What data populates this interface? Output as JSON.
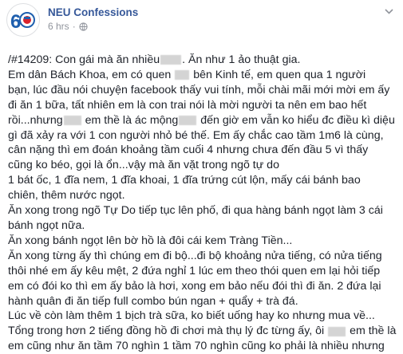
{
  "page": {
    "name": "NEU Confessions",
    "time": "6 hrs",
    "privacy_icon": "globe-icon",
    "menu_icon": "chevron-down-icon",
    "avatar_text": "60"
  },
  "post": {
    "lines": [
      "/#14209: Con gái mà ăn nhiều",
      "Ăn như 1 ảo thuật gia.",
      "Em dân Bách Khoa, em có quen",
      "bên Kinh tế, em quen qua 1 người",
      "bạn, lúc đầu nói chuyện facebook thấy vui tính, mỗi chài mãi mới mời em ấy",
      "đi ăn 1 bữa, tất nhiên em là con trai nói là mời người ta nên em bao hết",
      "rồi...nhưng",
      "em thề là ác mộng",
      "đến giờ em vẫn ko hiểu đc điều kì diệu",
      "gì đã xảy ra với 1 con người nhỏ bé thế. Em ấy chắc cao tầm 1m6 là cùng,",
      "cân nặng thì em đoán khoảng tầm cuối 4 nhưng chưa đến đầu 5 vì thấy",
      "cũng ko béo, gọi là ổn...vậy mà ăn vặt trong ngõ tự do",
      "1 bát ốc, 1 đĩa nem, 1 đĩa khoai, 1 đĩa trứng cút lộn, mấy cái bánh bao",
      "chiên, thêm nước ngọt.",
      "Ăn xong trong ngõ Tự Do tiếp tục lên phố, đi qua hàng bánh ngọt làm 3 cái",
      "bánh ngọt nữa.",
      "Ăn xong bánh ngọt lên bờ hồ là đôi cái kem Tràng Tiền...",
      "Ăn xong từng ấy thì chúng em đi bộ...đi bộ khoảng nửa tiếng, có nửa tiếng",
      "thôi nhé em ấy kêu mệt, 2 đứa nghỉ 1 lúc em theo thói quen em lại hỏi tiếp",
      "em có đói ko thì em ấy bảo là hơi, xong em bảo nếu đói thì đi ăn. 2 đứa lại",
      "hành quân đi ăn tiếp full combo bún ngan + quẩy + trà đá.",
      "Lúc về còn làm thêm 1 bịch trà sữa, ko biết uống hay ko nhưng mua về...",
      "Tổng trong hơn 2 tiếng đồng hồ đi chơi mà thụ lý đc từng ấy, ôi",
      "em thề là",
      "em cũng như ăn tầm 70 nghìn 1 tầm 70 nghìn cũng ko phải là nhiều nhưng"
    ]
  }
}
